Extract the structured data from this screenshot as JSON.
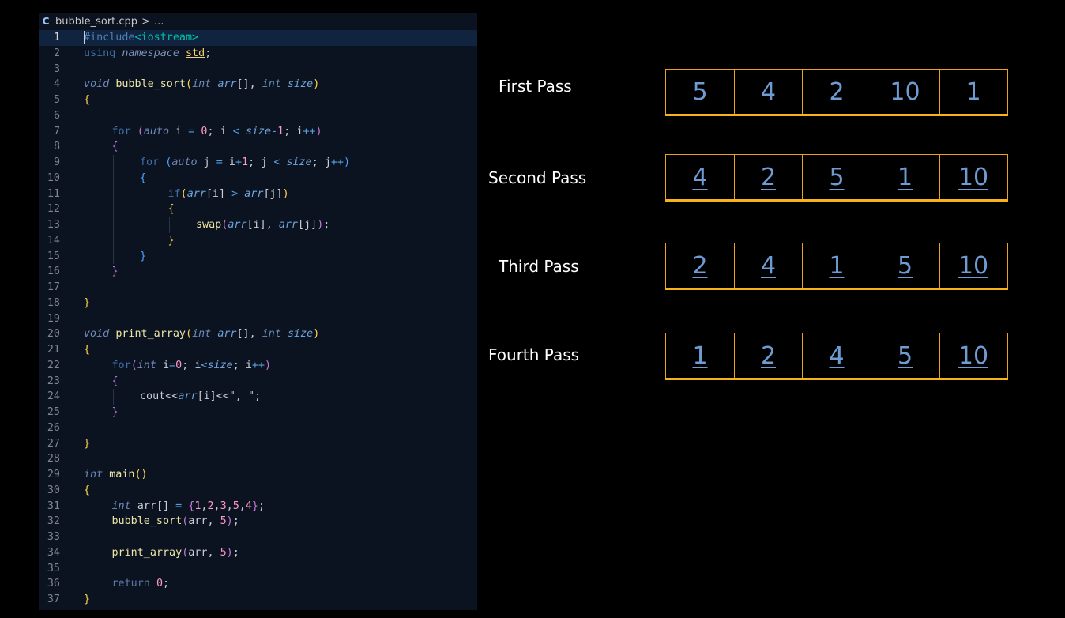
{
  "editor": {
    "breadcrumb": {
      "file_icon": "C",
      "file_name": "bubble_sort.cpp",
      "separator": ">",
      "tail": "..."
    },
    "lines": [
      {
        "n": "1",
        "indent": 0,
        "tokens": [
          [
            "#include",
            "pre"
          ],
          [
            "<iostream>",
            "inc"
          ]
        ]
      },
      {
        "n": "2",
        "indent": 0,
        "tokens": [
          [
            "using ",
            "kw"
          ],
          [
            "namespace ",
            "ns"
          ],
          [
            "std",
            "std"
          ],
          [
            ";",
            "pun"
          ]
        ]
      },
      {
        "n": "3",
        "indent": 0,
        "tokens": []
      },
      {
        "n": "4",
        "indent": 0,
        "tokens": [
          [
            "void ",
            "type"
          ],
          [
            "bubble_sort",
            "fn"
          ],
          [
            "(",
            "br"
          ],
          [
            "int ",
            "type"
          ],
          [
            "arr",
            "par"
          ],
          [
            "[]",
            "pun"
          ],
          [
            ", ",
            "pun"
          ],
          [
            "int ",
            "type"
          ],
          [
            "size",
            "par"
          ],
          [
            ")",
            "br"
          ]
        ]
      },
      {
        "n": "5",
        "indent": 0,
        "tokens": [
          [
            "{",
            "br"
          ]
        ]
      },
      {
        "n": "6",
        "indent": 0,
        "tokens": []
      },
      {
        "n": "7",
        "indent": 1,
        "tokens": [
          [
            "for ",
            "kw"
          ],
          [
            "(",
            "brp"
          ],
          [
            "auto ",
            "type"
          ],
          [
            "i ",
            "var"
          ],
          [
            "= ",
            "op"
          ],
          [
            "0",
            "num"
          ],
          [
            "; ",
            "pun"
          ],
          [
            "i ",
            "var"
          ],
          [
            "< ",
            "op"
          ],
          [
            "size",
            "par"
          ],
          [
            "-",
            "op"
          ],
          [
            "1",
            "num"
          ],
          [
            "; ",
            "pun"
          ],
          [
            "i",
            "var"
          ],
          [
            "++",
            "op"
          ],
          [
            ")",
            "brp"
          ]
        ]
      },
      {
        "n": "8",
        "indent": 1,
        "tokens": [
          [
            "{",
            "brp"
          ]
        ]
      },
      {
        "n": "9",
        "indent": 2,
        "tokens": [
          [
            "for ",
            "kw"
          ],
          [
            "(",
            "brb"
          ],
          [
            "auto ",
            "type"
          ],
          [
            "j ",
            "var"
          ],
          [
            "= ",
            "op"
          ],
          [
            "i",
            "var"
          ],
          [
            "+",
            "op"
          ],
          [
            "1",
            "num"
          ],
          [
            "; ",
            "pun"
          ],
          [
            "j ",
            "var"
          ],
          [
            "< ",
            "op"
          ],
          [
            "size",
            "par"
          ],
          [
            "; ",
            "pun"
          ],
          [
            "j",
            "var"
          ],
          [
            "++",
            "op"
          ],
          [
            ")",
            "brb"
          ]
        ]
      },
      {
        "n": "10",
        "indent": 2,
        "tokens": [
          [
            "{",
            "brb"
          ]
        ]
      },
      {
        "n": "11",
        "indent": 3,
        "tokens": [
          [
            "if",
            "kw"
          ],
          [
            "(",
            "br"
          ],
          [
            "arr",
            "par"
          ],
          [
            "[i]",
            "pun"
          ],
          [
            " > ",
            "op"
          ],
          [
            "arr",
            "par"
          ],
          [
            "[j]",
            "pun"
          ],
          [
            ")",
            "br"
          ]
        ]
      },
      {
        "n": "12",
        "indent": 3,
        "tokens": [
          [
            "{",
            "br"
          ]
        ]
      },
      {
        "n": "13",
        "indent": 4,
        "tokens": [
          [
            "swap",
            "fn"
          ],
          [
            "(",
            "brp"
          ],
          [
            "arr",
            "par"
          ],
          [
            "[i]",
            "pun"
          ],
          [
            ", ",
            "pun"
          ],
          [
            "arr",
            "par"
          ],
          [
            "[j]",
            "pun"
          ],
          [
            ")",
            "brp"
          ],
          [
            ";",
            "pun"
          ]
        ]
      },
      {
        "n": "14",
        "indent": 3,
        "tokens": [
          [
            "}",
            "br"
          ]
        ]
      },
      {
        "n": "15",
        "indent": 2,
        "tokens": [
          [
            "}",
            "brb"
          ]
        ]
      },
      {
        "n": "16",
        "indent": 1,
        "tokens": [
          [
            "}",
            "brp"
          ]
        ]
      },
      {
        "n": "17",
        "indent": 0,
        "tokens": []
      },
      {
        "n": "18",
        "indent": 0,
        "tokens": [
          [
            "}",
            "br"
          ]
        ]
      },
      {
        "n": "19",
        "indent": 0,
        "tokens": []
      },
      {
        "n": "20",
        "indent": 0,
        "tokens": [
          [
            "void ",
            "type"
          ],
          [
            "print_array",
            "fn"
          ],
          [
            "(",
            "br"
          ],
          [
            "int ",
            "type"
          ],
          [
            "arr",
            "par"
          ],
          [
            "[]",
            "pun"
          ],
          [
            ", ",
            "pun"
          ],
          [
            "int ",
            "type"
          ],
          [
            "size",
            "par"
          ],
          [
            ")",
            "br"
          ]
        ]
      },
      {
        "n": "21",
        "indent": 0,
        "tokens": [
          [
            "{",
            "br"
          ]
        ]
      },
      {
        "n": "22",
        "indent": 1,
        "tokens": [
          [
            "for",
            "kw"
          ],
          [
            "(",
            "brp"
          ],
          [
            "int ",
            "type"
          ],
          [
            "i",
            "var"
          ],
          [
            "=",
            "op"
          ],
          [
            "0",
            "num"
          ],
          [
            "; ",
            "pun"
          ],
          [
            "i",
            "var"
          ],
          [
            "<",
            "op"
          ],
          [
            "size",
            "par"
          ],
          [
            "; ",
            "pun"
          ],
          [
            "i",
            "var"
          ],
          [
            "++",
            "op"
          ],
          [
            ")",
            "brp"
          ]
        ]
      },
      {
        "n": "23",
        "indent": 1,
        "tokens": [
          [
            "{",
            "brp"
          ]
        ]
      },
      {
        "n": "24",
        "indent": 2,
        "tokens": [
          [
            "cout",
            "var"
          ],
          [
            "<<",
            "pun"
          ],
          [
            "arr",
            "par"
          ],
          [
            "[i]",
            "pun"
          ],
          [
            "<<",
            "pun"
          ],
          [
            "\", \"",
            "str"
          ],
          [
            ";",
            "pun"
          ]
        ]
      },
      {
        "n": "25",
        "indent": 1,
        "tokens": [
          [
            "}",
            "brp"
          ]
        ]
      },
      {
        "n": "26",
        "indent": 0,
        "tokens": []
      },
      {
        "n": "27",
        "indent": 0,
        "tokens": [
          [
            "}",
            "br"
          ]
        ]
      },
      {
        "n": "28",
        "indent": 0,
        "tokens": []
      },
      {
        "n": "29",
        "indent": 0,
        "tokens": [
          [
            "int ",
            "type"
          ],
          [
            "main",
            "fn"
          ],
          [
            "()",
            "br"
          ]
        ]
      },
      {
        "n": "30",
        "indent": 0,
        "tokens": [
          [
            "{",
            "br"
          ]
        ]
      },
      {
        "n": "31",
        "indent": 1,
        "tokens": [
          [
            "int ",
            "type"
          ],
          [
            "arr",
            "var"
          ],
          [
            "[] ",
            "pun"
          ],
          [
            "= ",
            "op"
          ],
          [
            "{",
            "brp"
          ],
          [
            "1",
            "num"
          ],
          [
            ",",
            "pun"
          ],
          [
            "2",
            "num"
          ],
          [
            ",",
            "pun"
          ],
          [
            "3",
            "num"
          ],
          [
            ",",
            "pun"
          ],
          [
            "5",
            "num"
          ],
          [
            ",",
            "pun"
          ],
          [
            "4",
            "num"
          ],
          [
            "}",
            "brp"
          ],
          [
            ";",
            "pun"
          ]
        ]
      },
      {
        "n": "32",
        "indent": 1,
        "tokens": [
          [
            "bubble_sort",
            "fn"
          ],
          [
            "(",
            "brp"
          ],
          [
            "arr",
            "var"
          ],
          [
            ", ",
            "pun"
          ],
          [
            "5",
            "num"
          ],
          [
            ")",
            "brp"
          ],
          [
            ";",
            "pun"
          ]
        ]
      },
      {
        "n": "33",
        "indent": 0,
        "tokens": []
      },
      {
        "n": "34",
        "indent": 1,
        "tokens": [
          [
            "print_array",
            "fn"
          ],
          [
            "(",
            "brp"
          ],
          [
            "arr",
            "var"
          ],
          [
            ", ",
            "pun"
          ],
          [
            "5",
            "num"
          ],
          [
            ")",
            "brp"
          ],
          [
            ";",
            "pun"
          ]
        ]
      },
      {
        "n": "35",
        "indent": 0,
        "tokens": []
      },
      {
        "n": "36",
        "indent": 1,
        "tokens": [
          [
            "return ",
            "ret"
          ],
          [
            "0",
            "num"
          ],
          [
            ";",
            "pun"
          ]
        ]
      },
      {
        "n": "37",
        "indent": 0,
        "tokens": [
          [
            "}",
            "br"
          ]
        ]
      }
    ]
  },
  "diagram": {
    "passes": [
      {
        "label": "First Pass",
        "values": [
          "5",
          "4",
          "2",
          "10",
          "1"
        ]
      },
      {
        "label": "Second Pass",
        "values": [
          "4",
          "2",
          "5",
          "1",
          "10"
        ]
      },
      {
        "label": "Third Pass",
        "values": [
          "2",
          "4",
          "1",
          "5",
          "10"
        ]
      },
      {
        "label": "Fourth Pass",
        "values": [
          "1",
          "2",
          "4",
          "5",
          "10"
        ]
      }
    ],
    "colors": {
      "cell_border": "#e8a21b",
      "cell_text": "#6e9bd2",
      "label_text": "#ffffff"
    }
  }
}
